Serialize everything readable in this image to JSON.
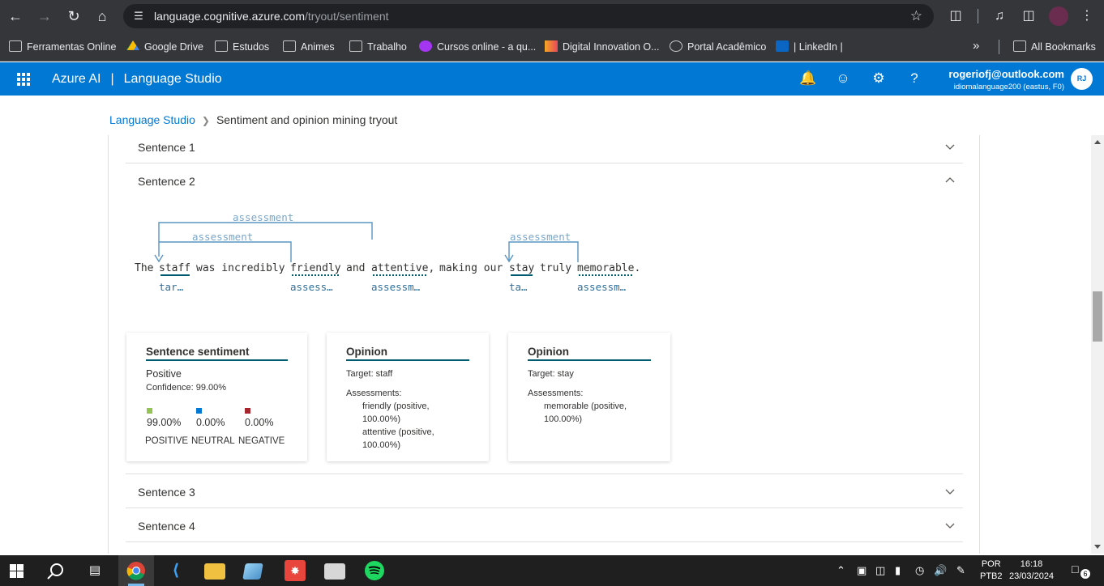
{
  "browser": {
    "url_host": "language.cognitive.azure.com",
    "url_path": "/tryout/sentiment"
  },
  "bookmarks": [
    {
      "label": "Ferramentas Online",
      "icon": "folder-icon"
    },
    {
      "label": "Google Drive",
      "icon": "google-drive-icon"
    },
    {
      "label": "Estudos",
      "icon": "folder-icon"
    },
    {
      "label": "Animes",
      "icon": "folder-icon"
    },
    {
      "label": "Trabalho",
      "icon": "folder-icon"
    },
    {
      "label": "Cursos online - a qu...",
      "icon": "udemy-icon"
    },
    {
      "label": "Digital Innovation O...",
      "icon": "dio-icon"
    },
    {
      "label": "Portal Acadêmico",
      "icon": "globe-icon"
    },
    {
      "label": "| LinkedIn |",
      "icon": "linkedin-icon"
    }
  ],
  "bookmarks_all": "All Bookmarks",
  "header": {
    "brand": "Azure AI",
    "pipe": "|",
    "product": "Language Studio",
    "user_email": "rogeriofj@outlook.com",
    "user_resource": "idiomalanguage200 (eastus, F0)",
    "avatar_initials": "RJ"
  },
  "breadcrumb": {
    "root": "Language Studio",
    "current": "Sentiment and opinion mining tryout"
  },
  "sentences": [
    {
      "label": "Sentence 1",
      "expanded": false
    },
    {
      "label": "Sentence 2",
      "expanded": true
    },
    {
      "label": "Sentence 3",
      "expanded": false
    },
    {
      "label": "Sentence 4",
      "expanded": false
    }
  ],
  "visualization": {
    "tokens": [
      "The",
      "staff",
      "was incredibly",
      "friendly",
      "and",
      "attentive,",
      "making our",
      "stay",
      "truly",
      "memorable."
    ],
    "arc_label": "assessment",
    "tags": {
      "staff": "tar…",
      "friendly": "assess…",
      "attentive": "assessm…",
      "stay": "ta…",
      "memorable": "assessm…"
    }
  },
  "sentiment_card": {
    "title": "Sentence sentiment",
    "label": "Positive",
    "confidence": "Confidence: 99.00%",
    "positive_value": "99.00%",
    "neutral_value": "0.00%",
    "negative_value": "0.00%",
    "positive_label": "POSITIVE",
    "neutral_label": "NEUTRAL",
    "negative_label": "NEGATIVE",
    "colors": {
      "positive": "#92c353",
      "neutral": "#0078d4",
      "negative": "#a4262c"
    }
  },
  "opinion_cards": [
    {
      "title": "Opinion",
      "target": "Target: staff",
      "assessments_label": "Assessments:",
      "assessments": [
        "friendly (positive,",
        "100.00%)",
        "attentive (positive,",
        "100.00%)"
      ]
    },
    {
      "title": "Opinion",
      "target": "Target: stay",
      "assessments_label": "Assessments:",
      "assessments": [
        "memorable (positive,",
        "100.00%)"
      ]
    }
  ],
  "taskbar": {
    "lang_line1": "POR",
    "lang_line2": "PTB2",
    "time": "16:18",
    "date": "23/03/2024",
    "notification_count": "6"
  }
}
